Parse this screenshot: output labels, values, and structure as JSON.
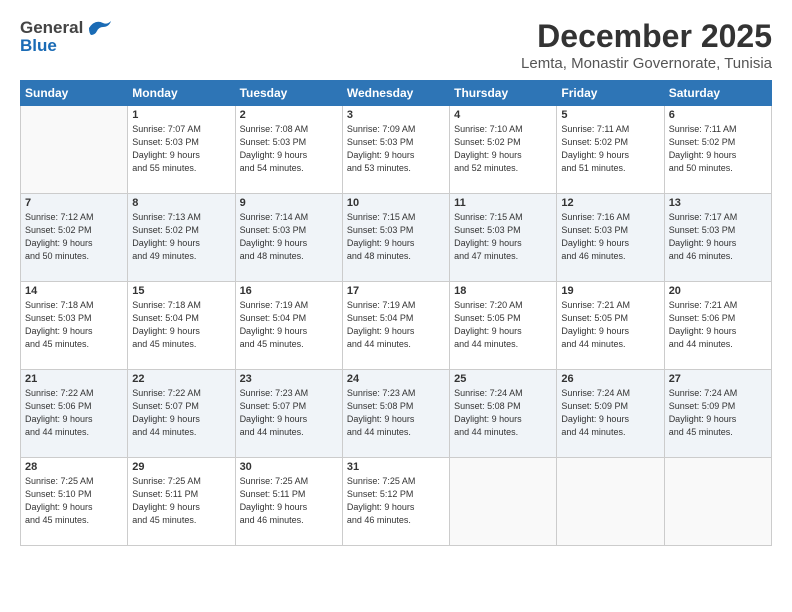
{
  "header": {
    "logo_general": "General",
    "logo_blue": "Blue",
    "main_title": "December 2025",
    "subtitle": "Lemta, Monastir Governorate, Tunisia"
  },
  "weekdays": [
    "Sunday",
    "Monday",
    "Tuesday",
    "Wednesday",
    "Thursday",
    "Friday",
    "Saturday"
  ],
  "weeks": [
    [
      {
        "day": "",
        "info": ""
      },
      {
        "day": "1",
        "info": "Sunrise: 7:07 AM\nSunset: 5:03 PM\nDaylight: 9 hours\nand 55 minutes."
      },
      {
        "day": "2",
        "info": "Sunrise: 7:08 AM\nSunset: 5:03 PM\nDaylight: 9 hours\nand 54 minutes."
      },
      {
        "day": "3",
        "info": "Sunrise: 7:09 AM\nSunset: 5:03 PM\nDaylight: 9 hours\nand 53 minutes."
      },
      {
        "day": "4",
        "info": "Sunrise: 7:10 AM\nSunset: 5:02 PM\nDaylight: 9 hours\nand 52 minutes."
      },
      {
        "day": "5",
        "info": "Sunrise: 7:11 AM\nSunset: 5:02 PM\nDaylight: 9 hours\nand 51 minutes."
      },
      {
        "day": "6",
        "info": "Sunrise: 7:11 AM\nSunset: 5:02 PM\nDaylight: 9 hours\nand 50 minutes."
      }
    ],
    [
      {
        "day": "7",
        "info": "Sunrise: 7:12 AM\nSunset: 5:02 PM\nDaylight: 9 hours\nand 50 minutes."
      },
      {
        "day": "8",
        "info": "Sunrise: 7:13 AM\nSunset: 5:02 PM\nDaylight: 9 hours\nand 49 minutes."
      },
      {
        "day": "9",
        "info": "Sunrise: 7:14 AM\nSunset: 5:03 PM\nDaylight: 9 hours\nand 48 minutes."
      },
      {
        "day": "10",
        "info": "Sunrise: 7:15 AM\nSunset: 5:03 PM\nDaylight: 9 hours\nand 48 minutes."
      },
      {
        "day": "11",
        "info": "Sunrise: 7:15 AM\nSunset: 5:03 PM\nDaylight: 9 hours\nand 47 minutes."
      },
      {
        "day": "12",
        "info": "Sunrise: 7:16 AM\nSunset: 5:03 PM\nDaylight: 9 hours\nand 46 minutes."
      },
      {
        "day": "13",
        "info": "Sunrise: 7:17 AM\nSunset: 5:03 PM\nDaylight: 9 hours\nand 46 minutes."
      }
    ],
    [
      {
        "day": "14",
        "info": "Sunrise: 7:18 AM\nSunset: 5:03 PM\nDaylight: 9 hours\nand 45 minutes."
      },
      {
        "day": "15",
        "info": "Sunrise: 7:18 AM\nSunset: 5:04 PM\nDaylight: 9 hours\nand 45 minutes."
      },
      {
        "day": "16",
        "info": "Sunrise: 7:19 AM\nSunset: 5:04 PM\nDaylight: 9 hours\nand 45 minutes."
      },
      {
        "day": "17",
        "info": "Sunrise: 7:19 AM\nSunset: 5:04 PM\nDaylight: 9 hours\nand 44 minutes."
      },
      {
        "day": "18",
        "info": "Sunrise: 7:20 AM\nSunset: 5:05 PM\nDaylight: 9 hours\nand 44 minutes."
      },
      {
        "day": "19",
        "info": "Sunrise: 7:21 AM\nSunset: 5:05 PM\nDaylight: 9 hours\nand 44 minutes."
      },
      {
        "day": "20",
        "info": "Sunrise: 7:21 AM\nSunset: 5:06 PM\nDaylight: 9 hours\nand 44 minutes."
      }
    ],
    [
      {
        "day": "21",
        "info": "Sunrise: 7:22 AM\nSunset: 5:06 PM\nDaylight: 9 hours\nand 44 minutes."
      },
      {
        "day": "22",
        "info": "Sunrise: 7:22 AM\nSunset: 5:07 PM\nDaylight: 9 hours\nand 44 minutes."
      },
      {
        "day": "23",
        "info": "Sunrise: 7:23 AM\nSunset: 5:07 PM\nDaylight: 9 hours\nand 44 minutes."
      },
      {
        "day": "24",
        "info": "Sunrise: 7:23 AM\nSunset: 5:08 PM\nDaylight: 9 hours\nand 44 minutes."
      },
      {
        "day": "25",
        "info": "Sunrise: 7:24 AM\nSunset: 5:08 PM\nDaylight: 9 hours\nand 44 minutes."
      },
      {
        "day": "26",
        "info": "Sunrise: 7:24 AM\nSunset: 5:09 PM\nDaylight: 9 hours\nand 44 minutes."
      },
      {
        "day": "27",
        "info": "Sunrise: 7:24 AM\nSunset: 5:09 PM\nDaylight: 9 hours\nand 45 minutes."
      }
    ],
    [
      {
        "day": "28",
        "info": "Sunrise: 7:25 AM\nSunset: 5:10 PM\nDaylight: 9 hours\nand 45 minutes."
      },
      {
        "day": "29",
        "info": "Sunrise: 7:25 AM\nSunset: 5:11 PM\nDaylight: 9 hours\nand 45 minutes."
      },
      {
        "day": "30",
        "info": "Sunrise: 7:25 AM\nSunset: 5:11 PM\nDaylight: 9 hours\nand 46 minutes."
      },
      {
        "day": "31",
        "info": "Sunrise: 7:25 AM\nSunset: 5:12 PM\nDaylight: 9 hours\nand 46 minutes."
      },
      {
        "day": "",
        "info": ""
      },
      {
        "day": "",
        "info": ""
      },
      {
        "day": "",
        "info": ""
      }
    ]
  ]
}
